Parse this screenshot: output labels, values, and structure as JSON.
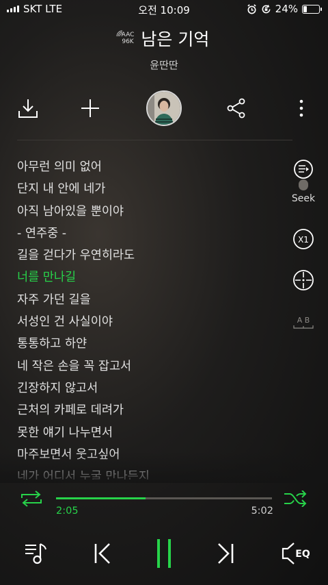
{
  "status_bar": {
    "carrier": "SKT LTE",
    "time": "오전 10:09",
    "battery_percent": "24%",
    "battery_level": 0.24,
    "icons": [
      "signal-icon",
      "alarm-icon",
      "orientation-lock-icon",
      "battery-icon"
    ]
  },
  "track": {
    "codec_line1": "AAC",
    "codec_line2": "96K",
    "title": "남은 기억",
    "artist": "윤딴딴"
  },
  "actions": [
    "download-icon",
    "add-icon",
    "album-art",
    "share-icon",
    "more-icon"
  ],
  "lyrics": {
    "current_index": 5,
    "lines": [
      "아무런 의미 없어",
      "단지 내 안에 네가",
      "아직 남아있을 뿐이야",
      " - 연주중 -",
      "길을 걷다가 우연히라도",
      "너를 만나길",
      "자주 가던 길을",
      "서성인 건 사실이야",
      "통통하고 하얀",
      "네 작은 손을 꼭 잡고서",
      "긴장하지 않고서",
      "근처의 카페로 데려가",
      "못한 얘기 나누면서",
      "마주보면서 웃고싶어",
      "네가 어디서 누굴 만나든지"
    ]
  },
  "side_controls": {
    "seek_label": "Seek",
    "speed_label": "X1",
    "ab_label": "A B"
  },
  "player": {
    "elapsed": "2:05",
    "total": "5:02",
    "progress_fraction": 0.414
  },
  "bottom_controls": [
    "playlist-icon",
    "previous-icon",
    "pause-icon",
    "next-icon",
    "eq-icon"
  ],
  "eq_label": "EQ",
  "colors": {
    "accent": "#27d34a",
    "background": "#1a1918"
  }
}
